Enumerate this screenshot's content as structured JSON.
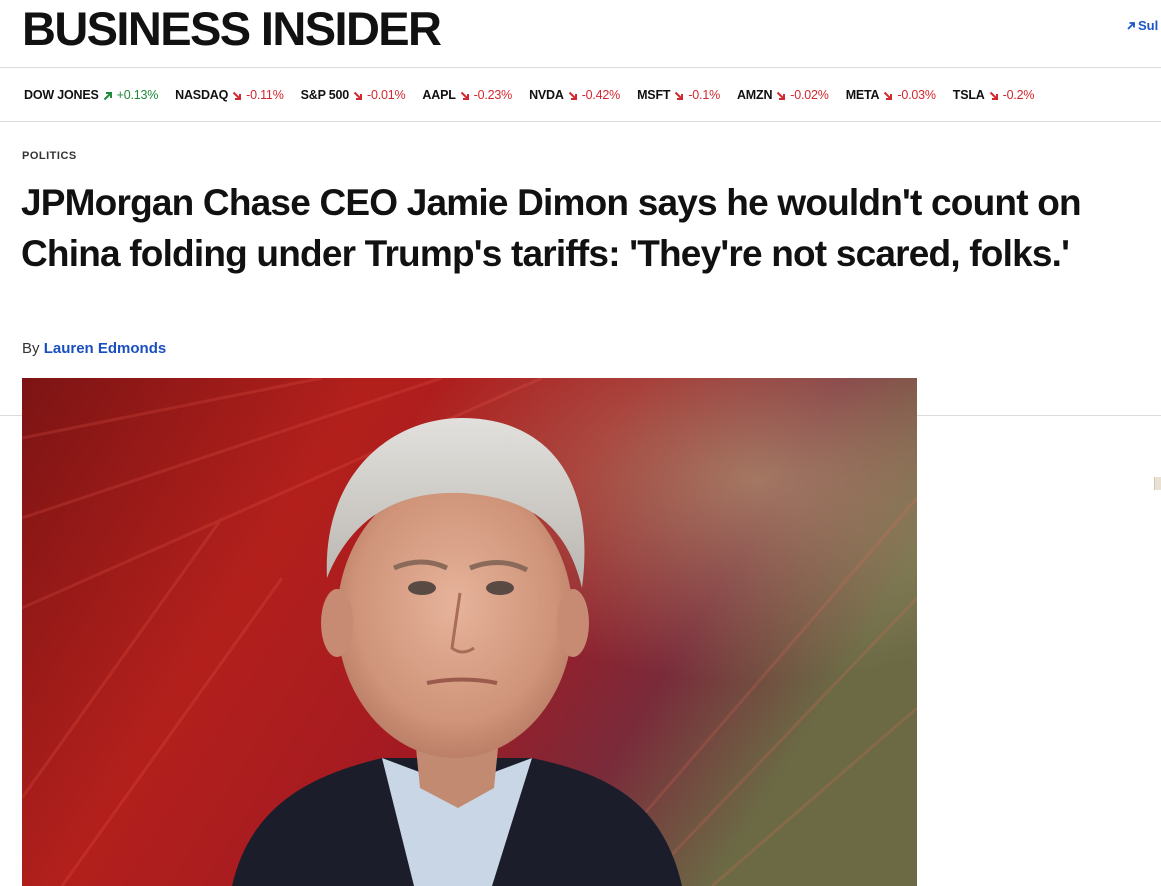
{
  "brand": {
    "logo_text": "BUSINESS INSIDER",
    "subscribe_label": "Sul"
  },
  "ticker": [
    {
      "name": "DOW JONES",
      "direction": "up",
      "change": "+0.13%"
    },
    {
      "name": "NASDAQ",
      "direction": "down",
      "change": "-0.11%"
    },
    {
      "name": "S&P 500",
      "direction": "down",
      "change": "-0.01%"
    },
    {
      "name": "AAPL",
      "direction": "down",
      "change": "-0.23%"
    },
    {
      "name": "NVDA",
      "direction": "down",
      "change": "-0.42%"
    },
    {
      "name": "MSFT",
      "direction": "down",
      "change": "-0.1%"
    },
    {
      "name": "AMZN",
      "direction": "down",
      "change": "-0.02%"
    },
    {
      "name": "META",
      "direction": "down",
      "change": "-0.03%"
    },
    {
      "name": "TSLA",
      "direction": "down",
      "change": "-0.2%"
    }
  ],
  "article": {
    "category": "POLITICS",
    "headline": "JPMorgan Chase CEO Jamie Dimon says he wouldn't count on China folding under Trump's tariffs: 'They're not scared, folks.'",
    "byline_prefix": "By",
    "author": "Lauren Edmonds"
  },
  "colors": {
    "accent_link": "#1a4fbf",
    "up": "#1f8a3c",
    "down": "#d3282f"
  },
  "icons": {
    "subscribe": "arrow-up-right-icon",
    "ticker_up": "arrow-up-right-icon",
    "ticker_down": "arrow-down-right-icon"
  }
}
